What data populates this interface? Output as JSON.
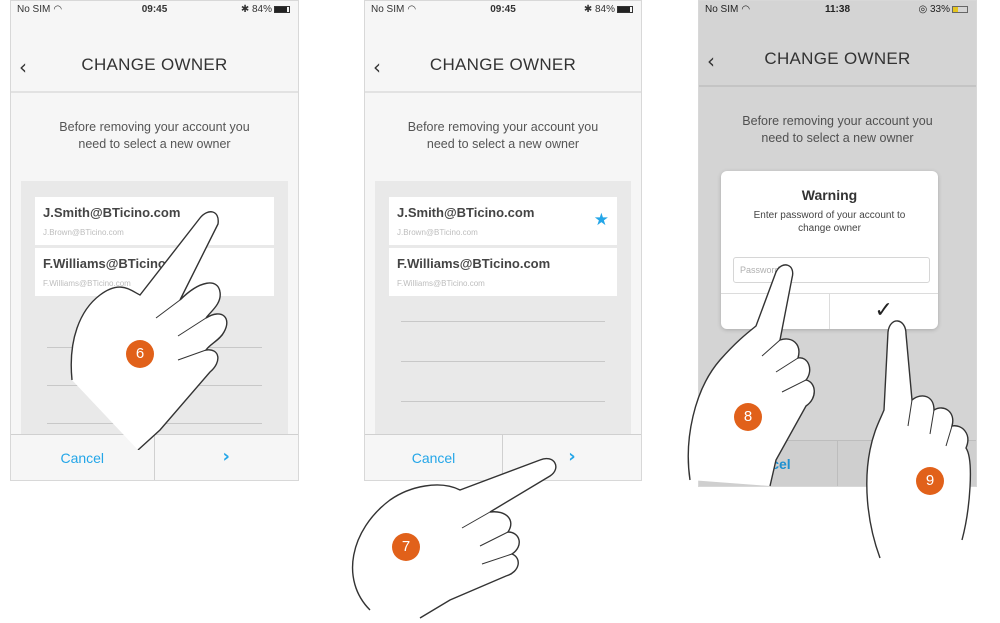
{
  "screens": [
    {
      "status": {
        "carrier": "No SIM",
        "time": "09:45",
        "battery": "84%"
      },
      "header": {
        "back": "‹",
        "title": "CHANGE OWNER"
      },
      "info": {
        "line1": "Before removing your account you",
        "line2": "need to select a new owner"
      },
      "users": [
        {
          "email": "J.Smith@BTicino.com",
          "sub": "J.Brown@BTicino.com"
        },
        {
          "email": "F.Williams@BTicino.com",
          "sub": "F.Williams@BTicino.com"
        }
      ],
      "actions": {
        "cancel": "Cancel",
        "next": "›"
      }
    },
    {
      "status": {
        "carrier": "No SIM",
        "time": "09:45",
        "battery": "84%"
      },
      "header": {
        "back": "‹",
        "title": "CHANGE OWNER"
      },
      "info": {
        "line1": "Before removing your account you",
        "line2": "need to select a new owner"
      },
      "users": [
        {
          "email": "J.Smith@BTicino.com",
          "sub": "J.Brown@BTicino.com",
          "star": "★"
        },
        {
          "email": "F.Williams@BTicino.com",
          "sub": "F.Williams@BTicino.com"
        }
      ],
      "actions": {
        "cancel": "Cancel",
        "next": "›"
      }
    },
    {
      "status": {
        "carrier": "No SIM",
        "time": "11:38",
        "battery": "33%"
      },
      "header": {
        "back": "‹",
        "title": "CHANGE OWNER"
      },
      "info": {
        "line1": "Before removing your account you",
        "line2": "need to select a new owner"
      },
      "dialog": {
        "title": "Warning",
        "line1": "Enter password of your account to",
        "line2": "change owner",
        "placeholder": "Password",
        "cancel_icon": "✕",
        "confirm_icon": "✓"
      },
      "actions": {
        "cancel": "Cancel",
        "confirm": "Confirm"
      }
    }
  ],
  "steps": [
    "6",
    "7",
    "8",
    "9"
  ],
  "colors": {
    "accent": "#24a6e8",
    "step_badge": "#e1611a"
  }
}
